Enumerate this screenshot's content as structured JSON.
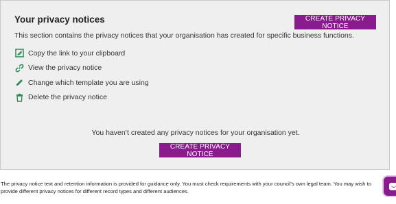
{
  "panel": {
    "title": "Your privacy notices",
    "description": "This section contains the privacy notices that your organisation has created for specific business functions.",
    "create_button_label": "CREATE PRIVACY NOTICE",
    "legend": [
      {
        "icon": "copy-link-icon",
        "label": "Copy the link to your clipboard"
      },
      {
        "icon": "link-icon",
        "label": "View the privacy notice"
      },
      {
        "icon": "pencil-icon",
        "label": "Change which template you are using"
      },
      {
        "icon": "trash-icon",
        "label": "Delete the privacy notice"
      }
    ],
    "empty_message": "You haven’t created any privacy notices for your organisation yet.",
    "create_button_bottom_label": "CREATE PRIVACY NOTICE"
  },
  "footnote": "The privacy notice text and retention information is provided for guidance only. You must check requirements with your council's own legal team. You may wish to provide different privacy notices for different record types and different audiences.",
  "colors": {
    "accent": "#8a1b8e",
    "icon": "#2e8b57",
    "panel_bg": "#efefef"
  },
  "chat_button": {
    "icon": "chat-icon"
  }
}
